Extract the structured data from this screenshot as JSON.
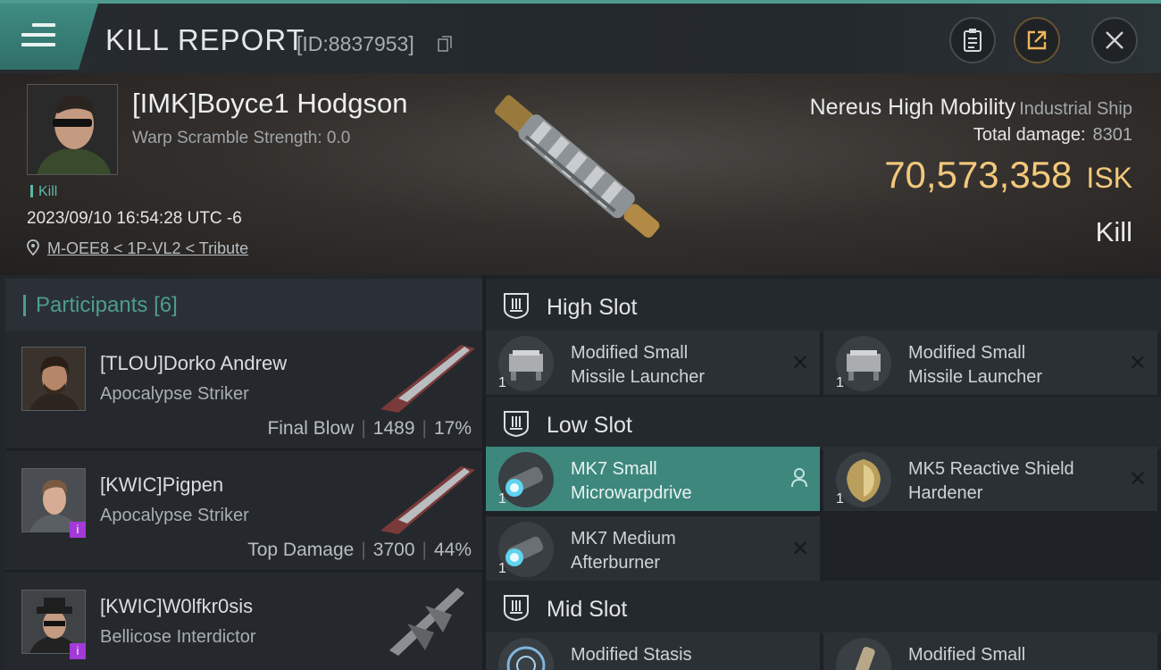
{
  "header": {
    "title": "KILL REPORT",
    "id": "[ID:8837953]",
    "icons": [
      "menu-icon",
      "copy-icon",
      "clipboard-icon",
      "share-icon",
      "close-icon"
    ]
  },
  "victim": {
    "name": "[IMK]Boyce1 Hodgson",
    "warp_scramble": "Warp Scramble Strength: 0.0",
    "tag": "Kill",
    "datetime": "2023/09/10 16:54:28 UTC -6",
    "location": "M-OEE8 < 1P-VL2 < Tribute",
    "ship_name": "Nereus High Mobility",
    "ship_class": "Industrial Ship",
    "total_damage_label": "Total damage:",
    "total_damage": "8301",
    "isk_value": "70,573,358",
    "isk_unit": "ISK",
    "result": "Kill"
  },
  "participants": {
    "label": "Participants",
    "count": "[6]",
    "rows": [
      {
        "name": "[TLOU]Dorko Andrew",
        "ship": "Apocalypse Striker",
        "role": "Final Blow",
        "damage": "1489",
        "percent": "17%",
        "badge": ""
      },
      {
        "name": "[KWIC]Pigpen",
        "ship": "Apocalypse Striker",
        "role": "Top Damage",
        "damage": "3700",
        "percent": "44%",
        "badge": "i"
      },
      {
        "name": "[KWIC]W0lfkr0sis",
        "ship": "Bellicose Interdictor",
        "role": "",
        "damage": "",
        "percent": "",
        "badge": "i"
      }
    ]
  },
  "slots": {
    "high": {
      "label": "High Slot",
      "modules": [
        {
          "line1": "Modified Small",
          "line2": "Missile Launcher",
          "qty": "1"
        },
        {
          "line1": "Modified Small",
          "line2": "Missile Launcher",
          "qty": "1"
        }
      ]
    },
    "low": {
      "label": "Low Slot",
      "modules": [
        {
          "line1": "MK7 Small",
          "line2": "Microwarpdrive",
          "qty": "1"
        },
        {
          "line1": "MK5 Reactive Shield",
          "line2": "Hardener",
          "qty": "1"
        },
        {
          "line1": "MK7 Medium",
          "line2": "Afterburner",
          "qty": "1"
        }
      ]
    },
    "mid": {
      "label": "Mid Slot",
      "modules": [
        {
          "line1": "Modified Stasis",
          "line2": "",
          "qty": ""
        },
        {
          "line1": "Modified Small",
          "line2": "",
          "qty": ""
        }
      ]
    }
  },
  "colors": {
    "accent": "#4e9b90",
    "isk": "#f3c87b",
    "active_module": "#3d877d",
    "badge": "#a23ad8"
  }
}
